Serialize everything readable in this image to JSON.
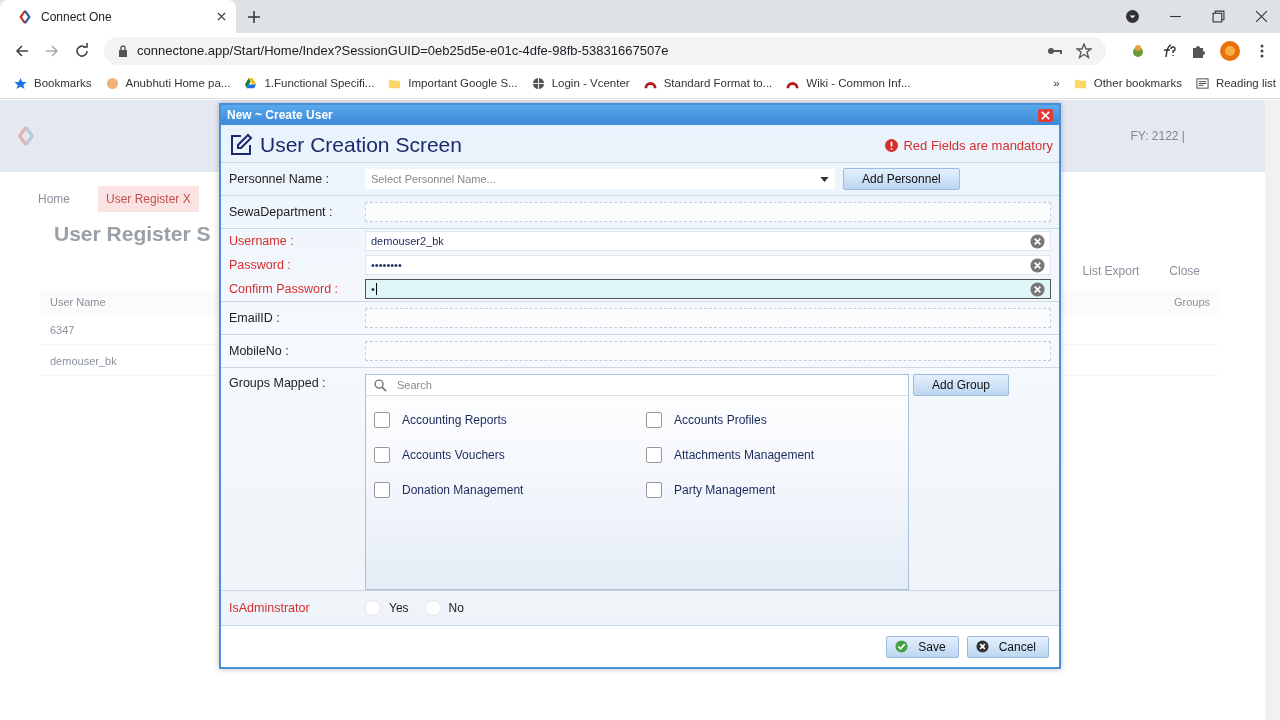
{
  "browser": {
    "tab_title": "Connect One",
    "url": "connectone.app/Start/Home/Index?SessionGUID=0eb25d5e-e01c-4dfe-98fb-53831667507e",
    "bookmarks": [
      {
        "label": "Bookmarks"
      },
      {
        "label": "Anubhuti Home pa..."
      },
      {
        "label": "1.Functional Specifi..."
      },
      {
        "label": "Important Google S..."
      },
      {
        "label": "Login - Vcenter"
      },
      {
        "label": "Standard Format to..."
      },
      {
        "label": "Wiki - Common Inf..."
      }
    ],
    "more_bookmarks": "»",
    "other_bookmarks": "Other bookmarks",
    "reading_list": "Reading list"
  },
  "app": {
    "header_info": "FY: 2122 |",
    "tabs": [
      {
        "label": "Home",
        "selected": false
      },
      {
        "label": "User Register X",
        "selected": true
      }
    ],
    "page_title": "User Register S",
    "toolbar": [
      "List Export",
      "Close"
    ],
    "columns": [
      "User Name",
      "Groups"
    ],
    "rows": [
      "6347",
      "demouser_bk"
    ]
  },
  "dialog": {
    "title": "New ~ Create User",
    "heading": "User Creation Screen",
    "mandatory_note": "Red Fields are mandatory",
    "personnel": {
      "label": "Personnel Name :",
      "placeholder": "Select Personnel Name...",
      "button": "Add Personnel"
    },
    "fields": [
      {
        "label": "SewaDepartment :",
        "required": false,
        "focused": false,
        "clearable": false
      },
      {
        "label": "Username :",
        "value": "demouser2_bk",
        "required": true,
        "focused": false,
        "clearable": true
      },
      {
        "label": "Password :",
        "value": "••••••••",
        "required": true,
        "focused": false,
        "clearable": true
      },
      {
        "label": "Confirm Password :",
        "value": "•",
        "required": true,
        "focused": true,
        "clearable": true
      },
      {
        "label": "EmailID :",
        "required": false,
        "focused": false,
        "clearable": false
      },
      {
        "label": "MobileNo :",
        "required": false,
        "focused": false,
        "clearable": false
      }
    ],
    "groups": {
      "label": "Groups Mapped :",
      "search_placeholder": "Search",
      "button": "Add Group",
      "items": [
        {
          "label": "Accounting Reports",
          "checked": false
        },
        {
          "label": "Accounts Profiles",
          "checked": false
        },
        {
          "label": "Accounts Vouchers",
          "checked": false
        },
        {
          "label": "Attachments Management",
          "checked": false
        },
        {
          "label": "Donation Management",
          "checked": false
        },
        {
          "label": "Party Management",
          "checked": false
        }
      ]
    },
    "admin": {
      "label": "IsAdminstrator",
      "options": [
        {
          "label": "Yes",
          "selected": false
        },
        {
          "label": "No",
          "selected": false
        }
      ]
    },
    "buttons": [
      {
        "label": "Save",
        "kind": "save"
      },
      {
        "label": "Cancel",
        "kind": "cancel"
      }
    ]
  }
}
